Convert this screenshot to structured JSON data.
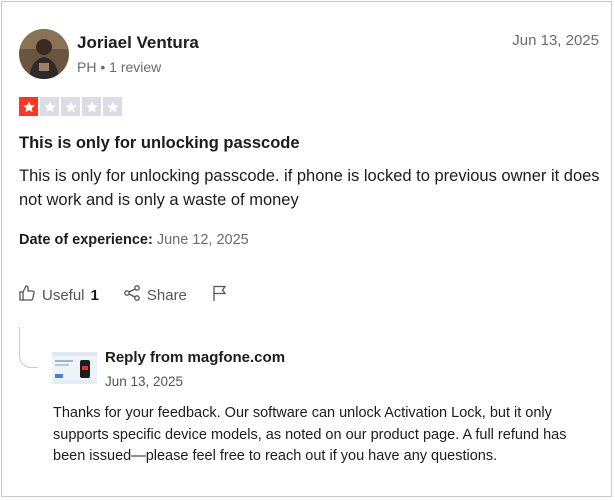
{
  "reviewer": {
    "name": "Joriael Ventura",
    "country": "PH",
    "review_count": "1 review"
  },
  "review": {
    "date": "Jun 13, 2025",
    "rating": 1,
    "rating_max": 5,
    "title": "This is only for unlocking passcode",
    "body": "This is only for unlocking passcode. if phone is locked to previous owner it does not work and is only a waste of money",
    "experience_label": "Date of experience:",
    "experience_date": "June 12, 2025"
  },
  "actions": {
    "useful_label": "Useful",
    "useful_count": "1",
    "share_label": "Share"
  },
  "reply": {
    "from_label": "Reply from magfone.com",
    "date": "Jun 13, 2025",
    "text": "Thanks for your feedback. Our software can unlock Activation Lock, but it only supports specific device models, as noted on our product page. A full refund has been issued—please feel free to reach out if you have any questions."
  },
  "colors": {
    "star_filled": "#ff3722",
    "star_empty": "#dcdce6"
  }
}
